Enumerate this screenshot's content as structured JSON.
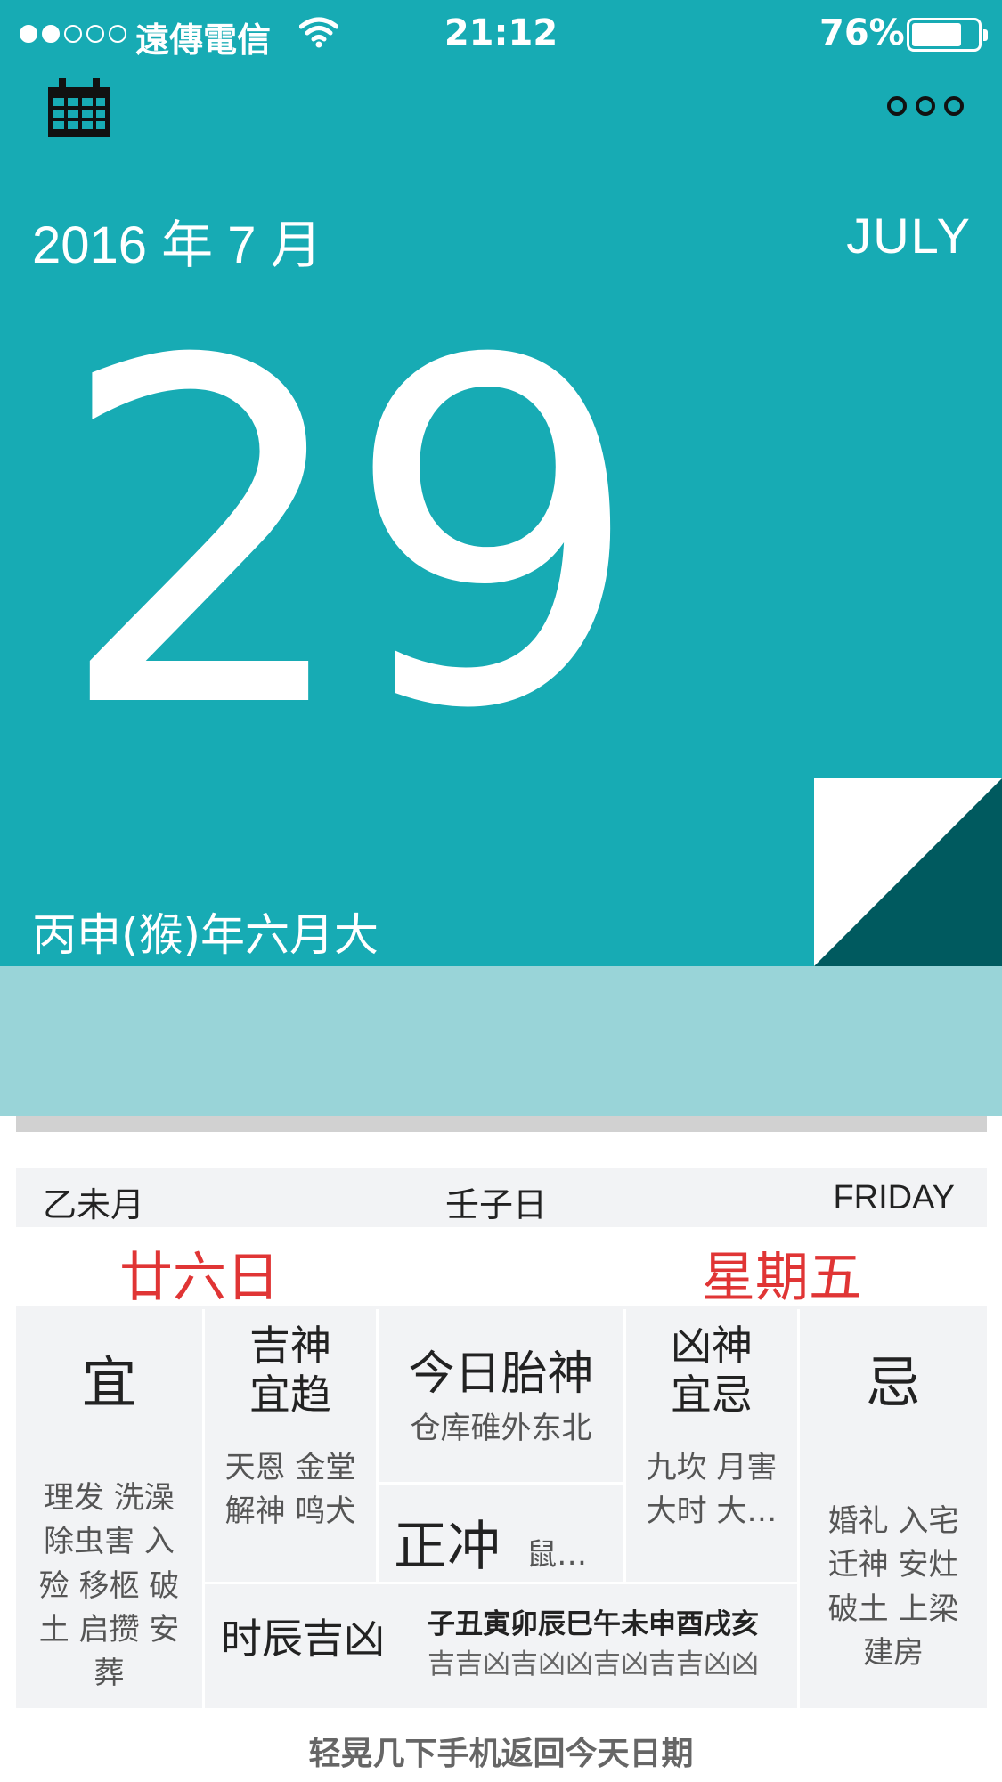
{
  "status_bar": {
    "carrier": "遠傳電信",
    "time": "21:12",
    "battery": "76%",
    "battery_level": 0.76
  },
  "header": {
    "year_month": "2016 年 7 月",
    "month_en": "JULY",
    "day": "29",
    "lunar_year": "丙申(猴)年六月大"
  },
  "info": {
    "ganzhi_month": "乙未月",
    "ganzhi_day": "壬子日",
    "weekday_en": "FRIDAY",
    "lunar_day": "廿六日",
    "weekday_cn": "星期五"
  },
  "grid": {
    "yi": {
      "title": "宜",
      "lines": [
        "理发 洗澡",
        "除虫害 入",
        "殓 移柩 破",
        "土 启攒 安",
        "葬"
      ]
    },
    "jishen": {
      "title1": "吉神",
      "title2": "宜趋",
      "lines": [
        "天恩 金堂",
        "解神 鸣犬"
      ]
    },
    "taishen": {
      "title": "今日胎神",
      "value": "仓库碓外东北"
    },
    "zhengchong": {
      "title": "正冲",
      "value": "鼠…"
    },
    "xiongshen": {
      "title1": "凶神",
      "title2": "宜忌",
      "lines": [
        "九坎 月害",
        "大时 大…"
      ]
    },
    "ji": {
      "title": "忌",
      "lines": [
        "婚礼 入宅",
        "迁神 安灶",
        "破土 上梁",
        "建房"
      ]
    },
    "shichen": {
      "title": "时辰吉凶",
      "branches": "子丑寅卯辰巳午未申酉戌亥",
      "luck": "吉吉凶吉凶凶吉凶吉吉凶凶"
    }
  },
  "hint": "轻晃几下手机返回今天日期",
  "colors": {
    "teal": "#17abb4",
    "band": "#99d4d8",
    "fold": "#005a5f",
    "red": "#e03535"
  },
  "icons": {
    "calendar": "calendar-icon",
    "more": "more-icon",
    "wifi": "wifi-icon"
  }
}
